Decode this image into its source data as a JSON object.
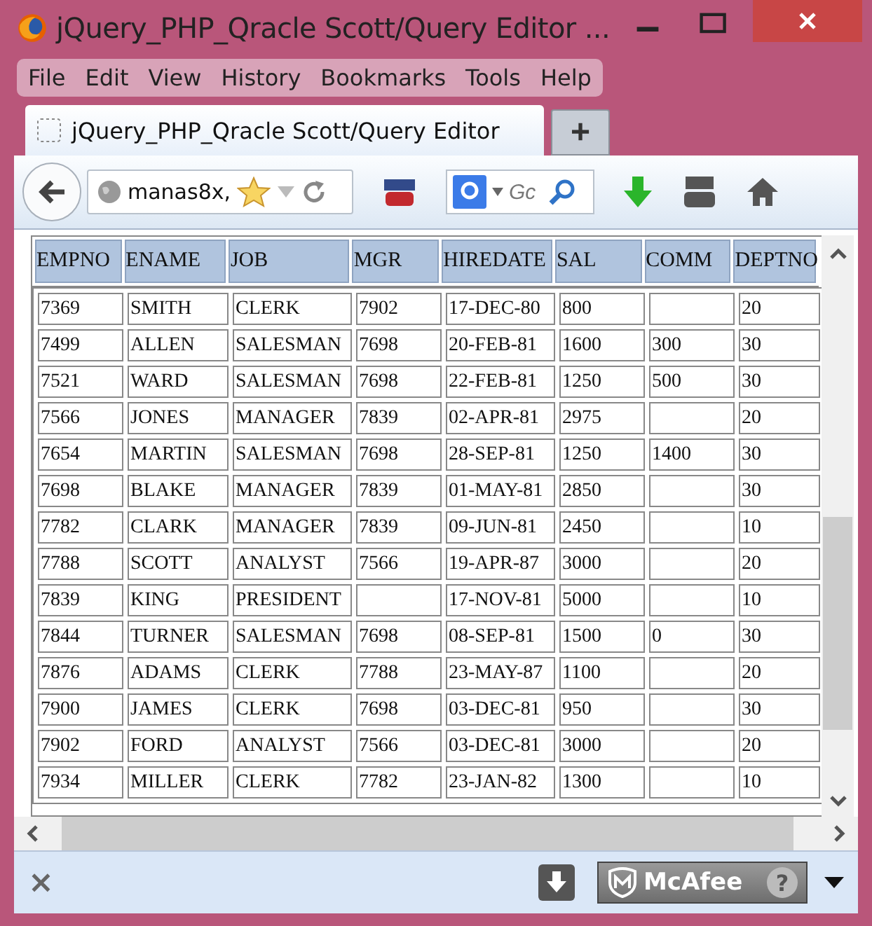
{
  "window": {
    "title": "jQuery_PHP_Qracle Scott/Query Editor ..."
  },
  "menu": [
    "File",
    "Edit",
    "View",
    "History",
    "Bookmarks",
    "Tools",
    "Help"
  ],
  "tabs": [
    {
      "label": "jQuery_PHP_Qracle Scott/Query Editor",
      "selected": true
    }
  ],
  "new_tab": "+",
  "address": {
    "value": "manas8x,"
  },
  "search": {
    "placeholder": "Gc"
  },
  "table": {
    "columns": [
      "EMPNO",
      "ENAME",
      "JOB",
      "MGR",
      "HIREDATE",
      "SAL",
      "COMM",
      "DEPTNO"
    ],
    "rows": [
      [
        "7369",
        "SMITH",
        "CLERK",
        "7902",
        "17-DEC-80",
        "800",
        "",
        "20"
      ],
      [
        "7499",
        "ALLEN",
        "SALESMAN",
        "7698",
        "20-FEB-81",
        "1600",
        "300",
        "30"
      ],
      [
        "7521",
        "WARD",
        "SALESMAN",
        "7698",
        "22-FEB-81",
        "1250",
        "500",
        "30"
      ],
      [
        "7566",
        "JONES",
        "MANAGER",
        "7839",
        "02-APR-81",
        "2975",
        "",
        "20"
      ],
      [
        "7654",
        "MARTIN",
        "SALESMAN",
        "7698",
        "28-SEP-81",
        "1250",
        "1400",
        "30"
      ],
      [
        "7698",
        "BLAKE",
        "MANAGER",
        "7839",
        "01-MAY-81",
        "2850",
        "",
        "30"
      ],
      [
        "7782",
        "CLARK",
        "MANAGER",
        "7839",
        "09-JUN-81",
        "2450",
        "",
        "10"
      ],
      [
        "7788",
        "SCOTT",
        "ANALYST",
        "7566",
        "19-APR-87",
        "3000",
        "",
        "20"
      ],
      [
        "7839",
        "KING",
        "PRESIDENT",
        "",
        "17-NOV-81",
        "5000",
        "",
        "10"
      ],
      [
        "7844",
        "TURNER",
        "SALESMAN",
        "7698",
        "08-SEP-81",
        "1500",
        "0",
        "30"
      ],
      [
        "7876",
        "ADAMS",
        "CLERK",
        "7788",
        "23-MAY-87",
        "1100",
        "",
        "20"
      ],
      [
        "7900",
        "JAMES",
        "CLERK",
        "7698",
        "03-DEC-81",
        "950",
        "",
        "30"
      ],
      [
        "7902",
        "FORD",
        "ANALYST",
        "7566",
        "03-DEC-81",
        "3000",
        "",
        "20"
      ],
      [
        "7934",
        "MILLER",
        "CLERK",
        "7782",
        "23-JAN-82",
        "1300",
        "",
        "10"
      ]
    ]
  },
  "status_bar": {
    "close": "×",
    "badge": "McAfee",
    "help": "?"
  }
}
